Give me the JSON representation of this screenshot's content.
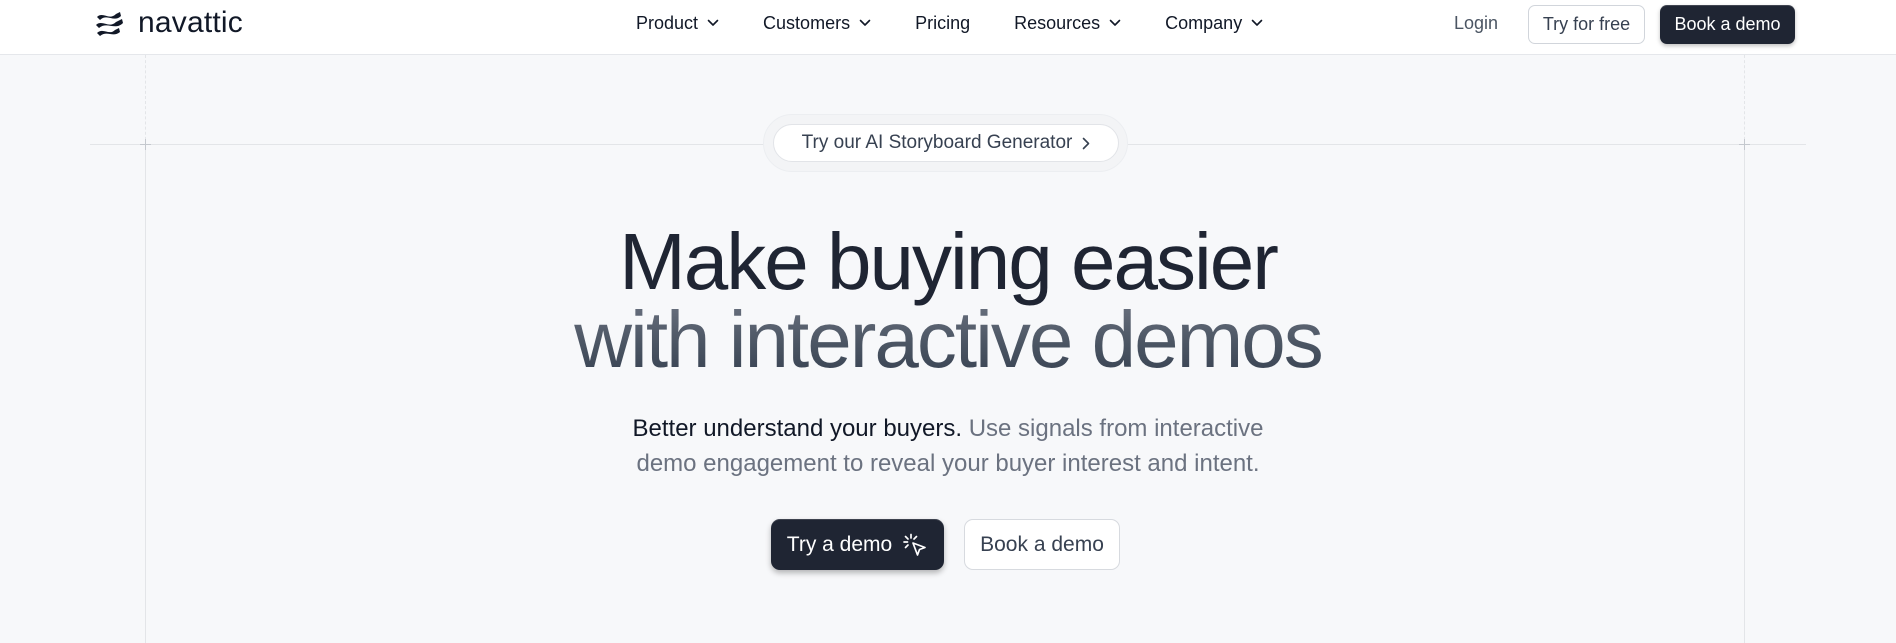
{
  "header": {
    "logo_text": "navattic",
    "nav": [
      {
        "label": "Product",
        "has_dropdown": true
      },
      {
        "label": "Customers",
        "has_dropdown": true
      },
      {
        "label": "Pricing",
        "has_dropdown": false
      },
      {
        "label": "Resources",
        "has_dropdown": true
      },
      {
        "label": "Company",
        "has_dropdown": true
      }
    ],
    "login_label": "Login",
    "try_free_label": "Try for free",
    "book_demo_label": "Book a demo"
  },
  "announcement": {
    "label": "Try our AI Storyboard Generator",
    "icon": "chevron-right-icon"
  },
  "hero": {
    "title_line1": "Make buying easier",
    "title_line2": "with interactive demos",
    "subtitle_lead": "Better understand your buyers.",
    "subtitle_rest": " Use signals from interactive",
    "subtitle_line2": "demo engagement to reveal your buyer interest and intent.",
    "primary_cta": "Try a demo",
    "primary_cta_icon": "click-cursor-icon",
    "secondary_cta": "Book a demo"
  },
  "colors": {
    "background": "#f7f8fa",
    "text_dark": "#1f2533",
    "text_muted": "#6b7280",
    "button_dark": "#1f2533"
  }
}
